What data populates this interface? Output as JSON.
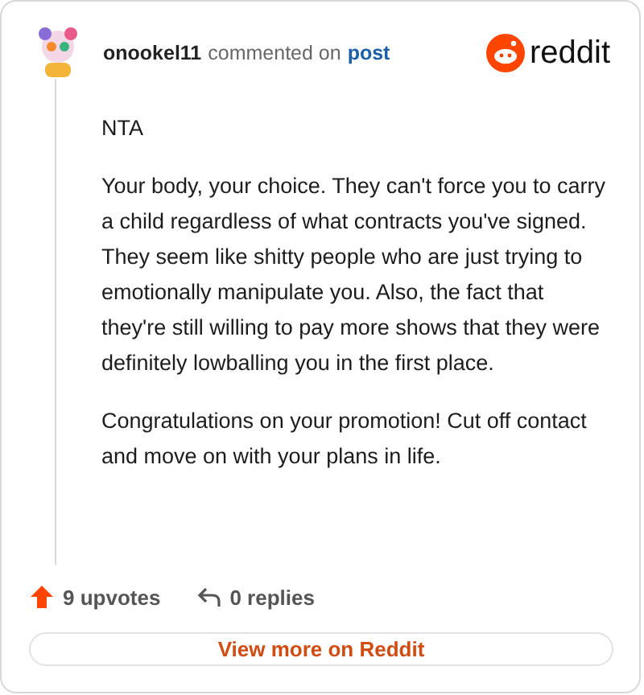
{
  "comment": {
    "author": "onookel11",
    "action": "commented on",
    "target": "post",
    "brand": "reddit",
    "paragraphs": [
      "NTA",
      "Your body, your choice. They can't force you to carry a child regardless of what contracts you've signed. They seem like shitty people who are just trying to emotionally manipulate you. Also, the fact that they're still willing to pay more shows that they were definitely lowballing you in the first place.",
      "Congratulations on your promotion! Cut off contact and move on with your plans in life."
    ],
    "upvotes": "9 upvotes",
    "replies": "0 replies"
  },
  "button": "View more on Reddit"
}
